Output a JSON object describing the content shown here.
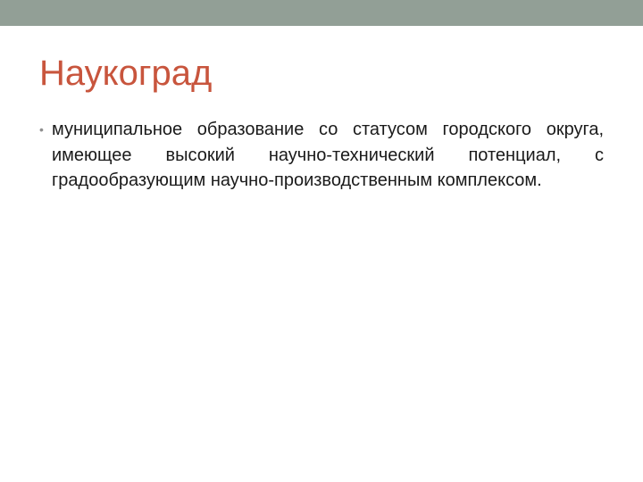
{
  "slide": {
    "title": "Наукоград",
    "bullets": [
      {
        "symbol": "•",
        "text": "муниципальное образование со статусом городского округа, имеющее высокий научно-технический потенциал, с градообразующим научно-производственным комплексом."
      }
    ]
  },
  "colors": {
    "top_bar": "#929f96",
    "title": "#c8553d",
    "body_text": "#1a1a1a",
    "bullet": "#8f8f8f"
  }
}
